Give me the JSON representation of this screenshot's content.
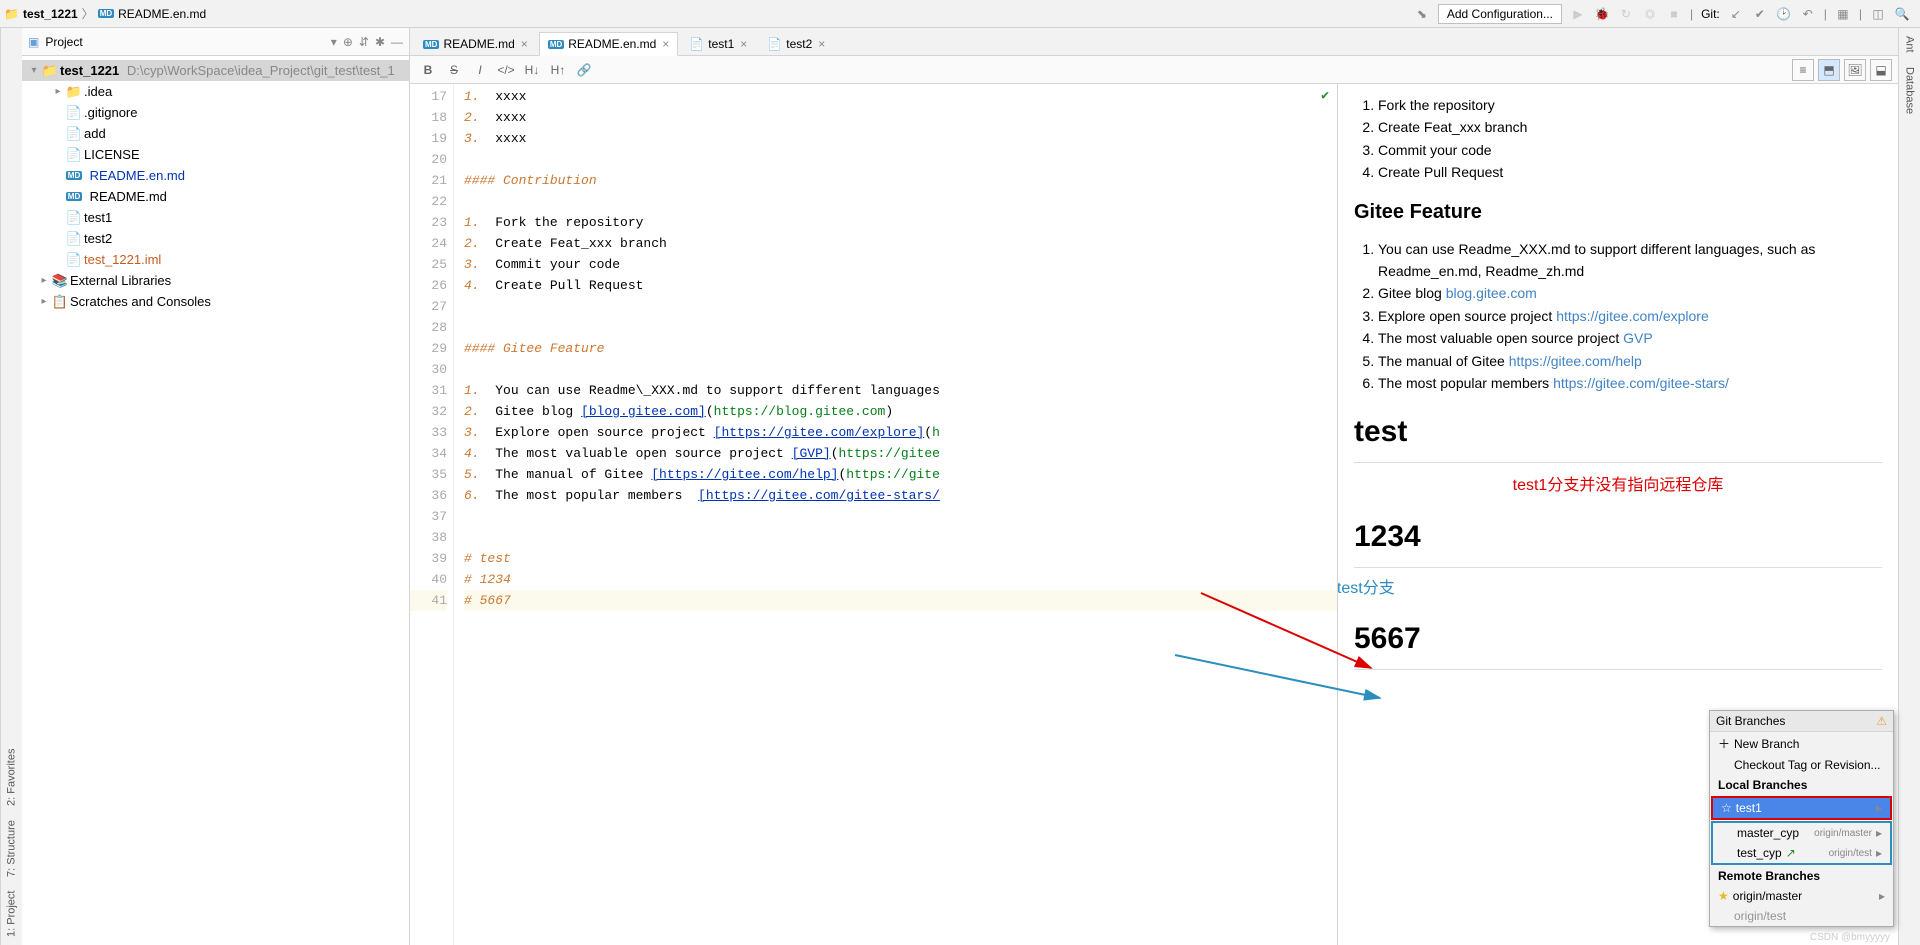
{
  "breadcrumb": {
    "project": "test_1221",
    "file": "README.en.md"
  },
  "toolbar": {
    "config": "Add Configuration...",
    "git_label": "Git:"
  },
  "project_panel": {
    "title": "Project",
    "root": "test_1221",
    "root_path": "D:\\cyp\\WorkSpace\\idea_Project\\git_test\\test_1",
    "items": [
      ".idea",
      ".gitignore",
      "add",
      "LICENSE",
      "README.en.md",
      "README.md",
      "test1",
      "test2",
      "test_1221.iml"
    ],
    "ext_lib": "External Libraries",
    "scratches": "Scratches and Consoles"
  },
  "tabs": [
    {
      "label": "README.md"
    },
    {
      "label": "README.en.md",
      "active": true
    },
    {
      "label": "test1"
    },
    {
      "label": "test2"
    }
  ],
  "gutter_start": 17,
  "code_lines": [
    {
      "n": 17,
      "html": "<span class='c-orange'>1.</span>  xxxx"
    },
    {
      "n": 18,
      "html": "<span class='c-orange'>2.</span>  xxxx"
    },
    {
      "n": 19,
      "html": "<span class='c-orange'>3.</span>  xxxx"
    },
    {
      "n": 20,
      "html": ""
    },
    {
      "n": 21,
      "html": "<span class='c-orange'>#### Contribution</span>"
    },
    {
      "n": 22,
      "html": ""
    },
    {
      "n": 23,
      "html": "<span class='c-orange'>1.</span>  Fork the repository"
    },
    {
      "n": 24,
      "html": "<span class='c-orange'>2.</span>  Create Feat_xxx branch"
    },
    {
      "n": 25,
      "html": "<span class='c-orange'>3.</span>  Commit your code"
    },
    {
      "n": 26,
      "html": "<span class='c-orange'>4.</span>  Create Pull Request"
    },
    {
      "n": 27,
      "html": ""
    },
    {
      "n": 28,
      "html": ""
    },
    {
      "n": 29,
      "html": "<span class='c-orange'>#### Gitee Feature</span>"
    },
    {
      "n": 30,
      "html": ""
    },
    {
      "n": 31,
      "html": "<span class='c-orange'>1.</span>  You can use Readme\\_XXX.md to support different languages"
    },
    {
      "n": 32,
      "html": "<span class='c-orange'>2.</span>  Gitee blog <span class='c-blue'>[blog.gitee.com]</span>(<span class='c-green'>https://blog.gitee.com</span>)"
    },
    {
      "n": 33,
      "html": "<span class='c-orange'>3.</span>  Explore open source project <span class='c-blue'>[https://gitee.com/explore]</span>(<span class='c-green'>h</span>"
    },
    {
      "n": 34,
      "html": "<span class='c-orange'>4.</span>  The most valuable open source project <span class='c-blue'>[GVP]</span>(<span class='c-green'>https://gitee</span>"
    },
    {
      "n": 35,
      "html": "<span class='c-orange'>5.</span>  The manual of Gitee <span class='c-blue'>[https://gitee.com/help]</span>(<span class='c-green'>https://gite</span>"
    },
    {
      "n": 36,
      "html": "<span class='c-orange'>6.</span>  The most popular members  <span class='c-blue'>[https://gitee.com/gitee-stars/</span>"
    },
    {
      "n": 37,
      "html": ""
    },
    {
      "n": 38,
      "html": ""
    },
    {
      "n": 39,
      "html": "<span class='c-orange'># test</span>"
    },
    {
      "n": 40,
      "html": "<span class='c-orange'># 1234</span>"
    },
    {
      "n": 41,
      "html": "<span class='c-orange hl-line'># 5667</span>"
    }
  ],
  "preview": {
    "list1": [
      "Fork the repository",
      "Create Feat_xxx branch",
      "Commit your code",
      "Create Pull Request"
    ],
    "h2": "Gitee Feature",
    "list2": [
      "You can use Readme_XXX.md to support different languages, such as Readme_en.md, Readme_zh.md",
      "Gitee blog <a href='#'>blog.gitee.com</a>",
      "Explore open source project <a href='#'>https://gitee.com/explore</a>",
      "The most valuable open source project <a href='#'>GVP</a>",
      "The manual of Gitee <a href='#'>https://gitee.com/help</a>",
      "The most popular members <a href='#'>https://gitee.com/gitee-stars/</a>"
    ],
    "h1a": "test",
    "h1b": "1234",
    "h1c": "5667"
  },
  "annotations": {
    "red": "test1分支并没有指向远程仓库",
    "blue": "另外两个分支可以看到分别指向了远程的master和test分支"
  },
  "popup": {
    "title": "Git Branches",
    "new_branch": "New Branch",
    "checkout": "Checkout Tag or Revision...",
    "local_hdr": "Local Branches",
    "local": [
      {
        "name": "test1",
        "selected": true
      },
      {
        "name": "master_cyp",
        "remote": "origin/master"
      },
      {
        "name": "test_cyp",
        "remote": "origin/test"
      }
    ],
    "remote_hdr": "Remote Branches",
    "remote": [
      {
        "name": "origin/master",
        "star": true
      },
      {
        "name": "origin/test"
      }
    ]
  },
  "left_tabs": [
    "1: Project",
    "7: Structure",
    "2: Favorites"
  ],
  "right_tabs": [
    "Ant",
    "Database"
  ],
  "watermark": "CSDN @bmyyyyy"
}
